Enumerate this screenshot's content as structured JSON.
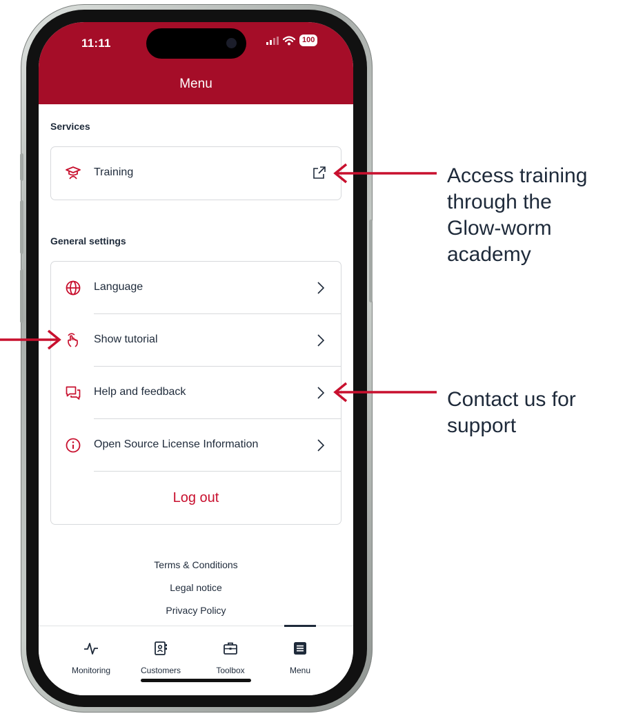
{
  "status_bar": {
    "time": "11:11",
    "battery": "100"
  },
  "header": {
    "title": "Menu"
  },
  "services": {
    "title": "Services",
    "items": [
      {
        "label": "Training",
        "icon": "graduation-cap-icon"
      }
    ]
  },
  "general_settings": {
    "title": "General settings",
    "items": [
      {
        "label": "Language",
        "icon": "globe-icon"
      },
      {
        "label": "Show tutorial",
        "icon": "pointer-hand-icon"
      },
      {
        "label": "Help and feedback",
        "icon": "chat-bubbles-icon"
      },
      {
        "label": "Open Source License Information",
        "icon": "info-icon"
      }
    ],
    "logout_label": "Log out"
  },
  "footer": {
    "links": [
      "Terms & Conditions",
      "Legal notice",
      "Privacy Policy"
    ]
  },
  "tabbar": {
    "tabs": [
      {
        "label": "Monitoring",
        "icon": "activity-icon"
      },
      {
        "label": "Customers",
        "icon": "contact-book-icon"
      },
      {
        "label": "Toolbox",
        "icon": "briefcase-icon"
      },
      {
        "label": "Menu",
        "icon": "list-icon",
        "active": true
      }
    ]
  },
  "annotations": {
    "training": [
      "Access training",
      "through the",
      "Glow-worm",
      "academy"
    ],
    "support": [
      "Contact us for",
      "support"
    ]
  },
  "colors": {
    "brand": "#a50d28",
    "accent": "#c8102e",
    "text": "#1e2a3a"
  }
}
